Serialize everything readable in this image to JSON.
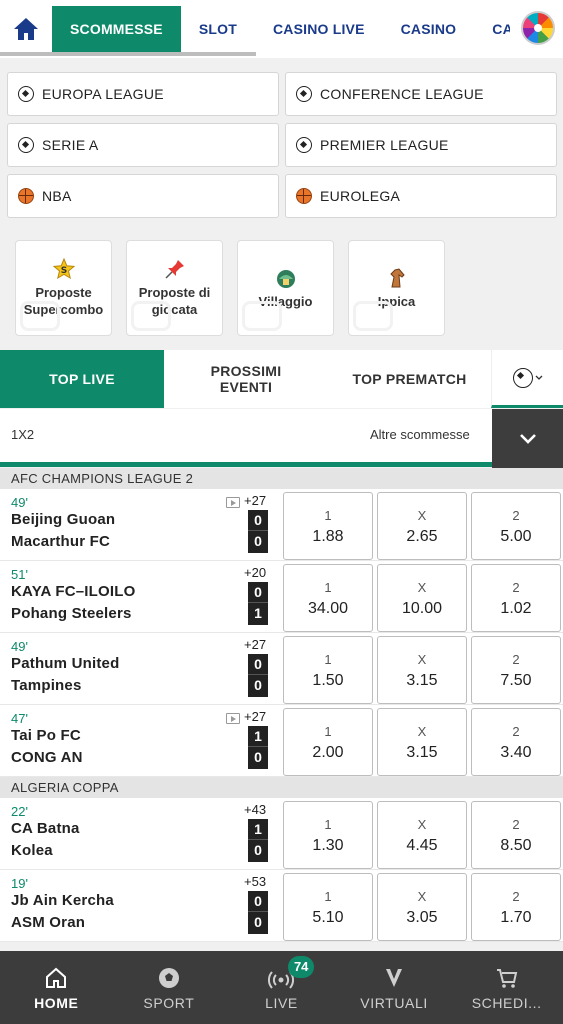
{
  "topnav": {
    "home_icon": "home-icon",
    "tabs": [
      {
        "label": "SCOMMESSE",
        "active": true
      },
      {
        "label": "SLOT",
        "active": false
      },
      {
        "label": "CASINO LIVE",
        "active": false
      },
      {
        "label": "CASINO",
        "active": false
      },
      {
        "label": "CARTE",
        "active": false
      }
    ],
    "wheel_icon": "prize-wheel-icon"
  },
  "leagues": [
    {
      "label": "EUROPA LEAGUE",
      "icon": "soccer-ball-icon"
    },
    {
      "label": "CONFERENCE LEAGUE",
      "icon": "soccer-ball-icon"
    },
    {
      "label": "SERIE A",
      "icon": "soccer-ball-icon"
    },
    {
      "label": "PREMIER LEAGUE",
      "icon": "soccer-ball-icon"
    },
    {
      "label": "NBA",
      "icon": "basketball-icon"
    },
    {
      "label": "EUROLEGA",
      "icon": "basketball-icon"
    }
  ],
  "promos": [
    {
      "label": "Proposte Supercombo",
      "icon": "supercombo-star-icon"
    },
    {
      "label": "Proposte di giocata",
      "icon": "pin-icon"
    },
    {
      "label": "Villaggio",
      "icon": "village-icon"
    },
    {
      "label": "Ippica",
      "icon": "horse-icon"
    }
  ],
  "sport_tabs": [
    {
      "label": "TOP LIVE",
      "active": true
    },
    {
      "label": "PROSSIMI EVENTI",
      "active": false
    },
    {
      "label": "TOP PREMATCH",
      "active": false
    }
  ],
  "market": {
    "selected": "1X2",
    "more": "Altre scommesse"
  },
  "competitions": [
    {
      "name": "AFC CHAMPIONS LEAGUE 2",
      "events": [
        {
          "minute": "49'",
          "home": "Beijing Guoan",
          "away": "Macarthur FC",
          "more": "+27",
          "stream": true,
          "score": [
            "0",
            "0"
          ],
          "odds": [
            {
              "l": "1",
              "v": "1.88"
            },
            {
              "l": "X",
              "v": "2.65"
            },
            {
              "l": "2",
              "v": "5.00"
            }
          ]
        },
        {
          "minute": "51'",
          "home": "KAYA FC–ILOILO",
          "away": "Pohang Steelers",
          "more": "+20",
          "stream": false,
          "score": [
            "0",
            "1"
          ],
          "odds": [
            {
              "l": "1",
              "v": "34.00"
            },
            {
              "l": "X",
              "v": "10.00"
            },
            {
              "l": "2",
              "v": "1.02"
            }
          ]
        },
        {
          "minute": "49'",
          "home": "Pathum United",
          "away": "Tampines",
          "more": "+27",
          "stream": false,
          "score": [
            "0",
            "0"
          ],
          "odds": [
            {
              "l": "1",
              "v": "1.50"
            },
            {
              "l": "X",
              "v": "3.15"
            },
            {
              "l": "2",
              "v": "7.50"
            }
          ]
        },
        {
          "minute": "47'",
          "home": "Tai Po FC",
          "away": "CONG AN",
          "more": "+27",
          "stream": true,
          "score": [
            "1",
            "0"
          ],
          "odds": [
            {
              "l": "1",
              "v": "2.00"
            },
            {
              "l": "X",
              "v": "3.15"
            },
            {
              "l": "2",
              "v": "3.40"
            }
          ]
        }
      ]
    },
    {
      "name": "ALGERIA COPPA",
      "events": [
        {
          "minute": "22'",
          "home": "CA Batna",
          "away": "Kolea",
          "more": "+43",
          "stream": false,
          "score": [
            "1",
            "0"
          ],
          "odds": [
            {
              "l": "1",
              "v": "1.30"
            },
            {
              "l": "X",
              "v": "4.45"
            },
            {
              "l": "2",
              "v": "8.50"
            }
          ]
        },
        {
          "minute": "19'",
          "home": "Jb Ain Kercha",
          "away": "ASM Oran",
          "more": "+53",
          "stream": false,
          "score": [
            "0",
            "0"
          ],
          "odds": [
            {
              "l": "1",
              "v": "5.10"
            },
            {
              "l": "X",
              "v": "3.05"
            },
            {
              "l": "2",
              "v": "1.70"
            }
          ]
        }
      ]
    }
  ],
  "bottom_nav": [
    {
      "label": "HOME",
      "icon": "home-icon",
      "active": true
    },
    {
      "label": "SPORT",
      "icon": "soccer-ball-icon",
      "active": false
    },
    {
      "label": "LIVE",
      "icon": "live-signal-icon",
      "active": false,
      "badge": "74"
    },
    {
      "label": "VIRTUALI",
      "icon": "virtual-icon",
      "active": false
    },
    {
      "label": "SCHEDI...",
      "icon": "cart-icon",
      "active": false
    }
  ],
  "colors": {
    "brand_green": "#0e8a6a",
    "nav_blue": "#1a3a8a",
    "bottom_bar": "#3c3c3c"
  }
}
